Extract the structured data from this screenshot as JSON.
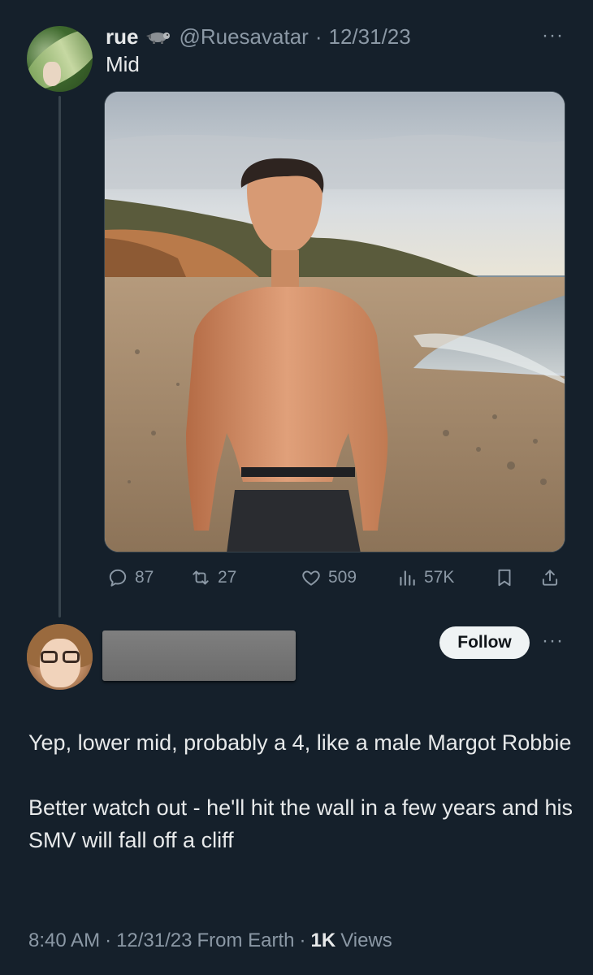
{
  "tweet1": {
    "name": "rue",
    "handle": "@Ruesavatar",
    "separator": "·",
    "date": "12/31/23",
    "text": "Mid",
    "more": "···",
    "stats": {
      "replies": "87",
      "retweets": "27",
      "likes": "509",
      "views": "57K"
    }
  },
  "tweet2": {
    "follow_label": "Follow",
    "more": "···",
    "paragraphs": [
      "Yep, lower mid, probably a 4, like a male Margot Robbie",
      "Better watch out - he'll hit the wall in a few years and his SMV will fall off a cliff"
    ],
    "time": "8:40 AM",
    "date": "12/31/23",
    "source": "From Earth",
    "views_count": "1K",
    "views_label": "Views",
    "separator": "·"
  },
  "colors": {
    "background": "#15202b",
    "text_primary": "#e7e9ea",
    "text_secondary": "#8b98a5",
    "follow_bg": "#eff3f4"
  }
}
